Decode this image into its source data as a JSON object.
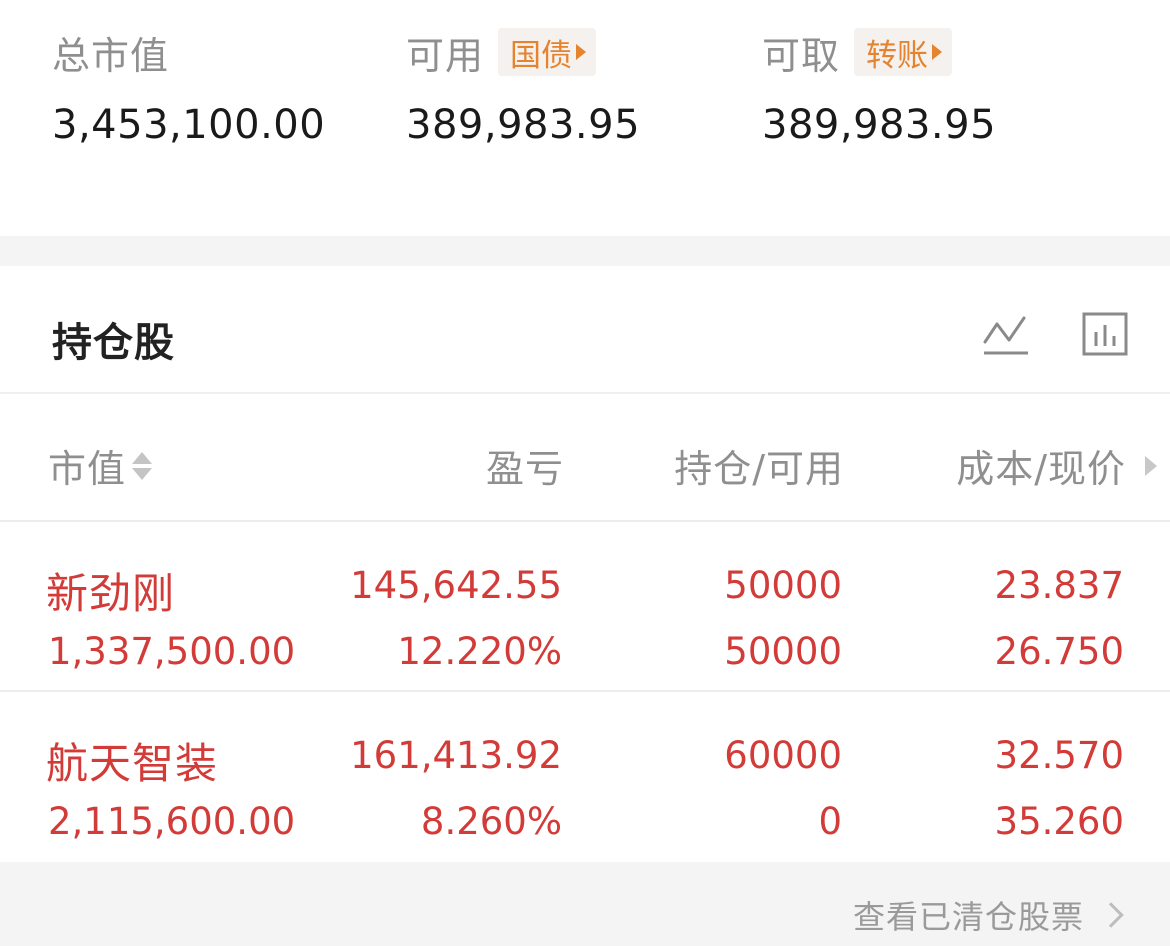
{
  "summary": {
    "total_market_value": {
      "label": "总市值",
      "value": "3,453,100.00"
    },
    "available": {
      "label": "可用",
      "tag": "国债",
      "value": "389,983.95"
    },
    "withdrawable": {
      "label": "可取",
      "tag": "转账",
      "value": "389,983.95"
    }
  },
  "positions": {
    "title": "持仓股",
    "icons": [
      "trend-line-icon",
      "bar-chart-icon"
    ],
    "columns": {
      "market_value": "市值",
      "profit_loss": "盈亏",
      "holding_available": "持仓/可用",
      "cost_price": "成本/现价"
    },
    "rows": [
      {
        "name": "新劲刚",
        "market_value": "1,337,500.00",
        "profit_loss": "145,642.55",
        "profit_loss_pct": "12.220%",
        "holding": "50000",
        "available": "50000",
        "cost": "23.837",
        "price": "26.750"
      },
      {
        "name": "航天智装",
        "market_value": "2,115,600.00",
        "profit_loss": "161,413.92",
        "profit_loss_pct": "8.260%",
        "holding": "60000",
        "available": "0",
        "cost": "32.570",
        "price": "35.260"
      }
    ]
  },
  "footer": {
    "link": "查看已清仓股票"
  },
  "colors": {
    "gain": "#d23b38",
    "tag": "#e5832f",
    "muted": "#8f8f8f"
  }
}
